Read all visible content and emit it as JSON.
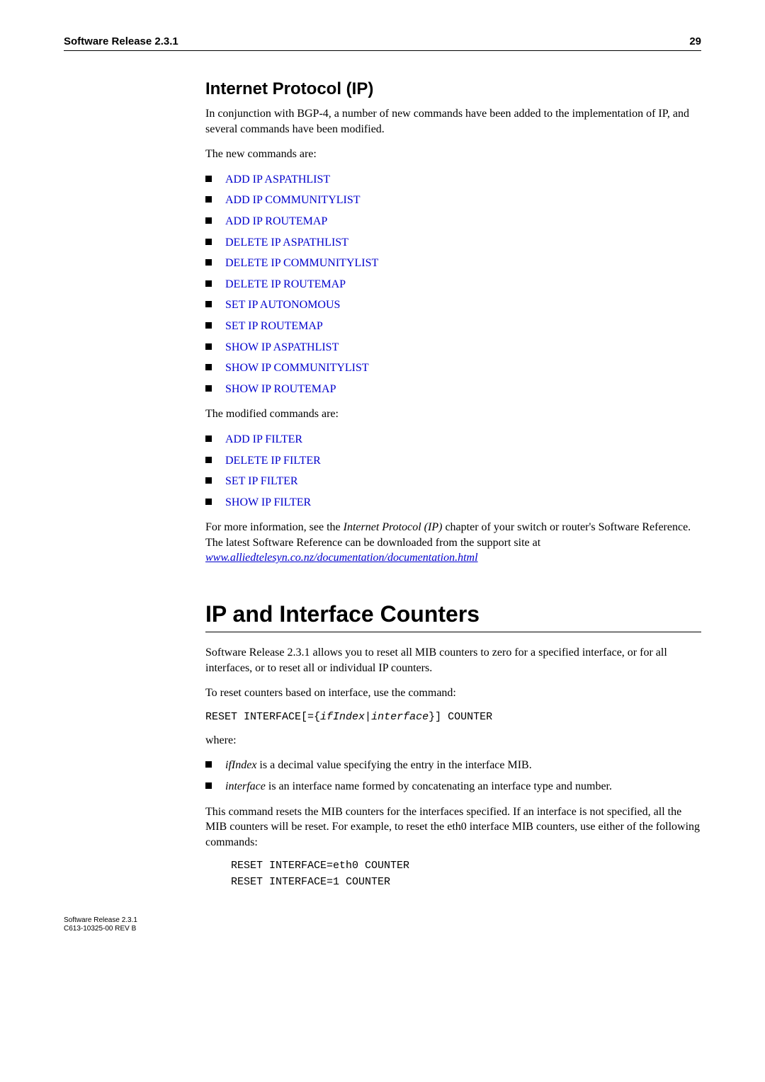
{
  "header": {
    "left": "Software Release 2.3.1",
    "right": "29"
  },
  "section1": {
    "title": "Internet Protocol (IP)",
    "intro": "In conjunction with BGP-4, a number of new commands have been added to the implementation of IP, and several commands have been modified.",
    "new_label": "The new commands are:",
    "new_cmds": [
      "ADD IP ASPATHLIST",
      "ADD IP COMMUNITYLIST",
      "ADD IP ROUTEMAP",
      "DELETE IP ASPATHLIST",
      "DELETE IP COMMUNITYLIST",
      "DELETE IP ROUTEMAP",
      "SET IP AUTONOMOUS",
      "SET IP ROUTEMAP",
      "SHOW IP ASPATHLIST",
      "SHOW IP COMMUNITYLIST",
      "SHOW IP ROUTEMAP"
    ],
    "mod_label": "The modified commands are:",
    "mod_cmds": [
      "ADD IP FILTER",
      "DELETE IP FILTER",
      "SET IP FILTER",
      "SHOW IP FILTER"
    ],
    "outro_pre": "For more information, see the ",
    "outro_em": "Internet Protocol (IP)",
    "outro_mid": " chapter of your switch or router's Software Reference. The latest Software Reference can be downloaded from the support site at ",
    "outro_link": "www.alliedtelesyn.co.nz/documentation/documentation.html"
  },
  "section2": {
    "title": "IP and Interface Counters",
    "p1": "Software Release 2.3.1 allows you to reset all MIB counters to zero for a specified interface, or for all interfaces, or to reset all or individual IP counters.",
    "p2": "To reset counters based on interface, use the command:",
    "code1_a": "RESET INTERFACE[={",
    "code1_b": "ifIndex",
    "code1_c": "|",
    "code1_d": "interface",
    "code1_e": "}] COUNTER",
    "where": "where:",
    "bullet1_em": "ifIndex",
    "bullet1_rest": " is a decimal value specifying the entry in the interface MIB.",
    "bullet2_em": "interface",
    "bullet2_rest": " is an interface name formed by concatenating an interface type and number.",
    "p3": "This command resets the MIB counters for the interfaces specified. If an interface is not specified, all the MIB counters will be reset. For example, to reset the eth0 interface MIB counters, use either of the following commands:",
    "code2": "RESET INTERFACE=eth0 COUNTER",
    "code3": "RESET INTERFACE=1 COUNTER"
  },
  "footer": {
    "l1": "Software Release 2.3.1",
    "l2": "C613-10325-00 REV B"
  }
}
